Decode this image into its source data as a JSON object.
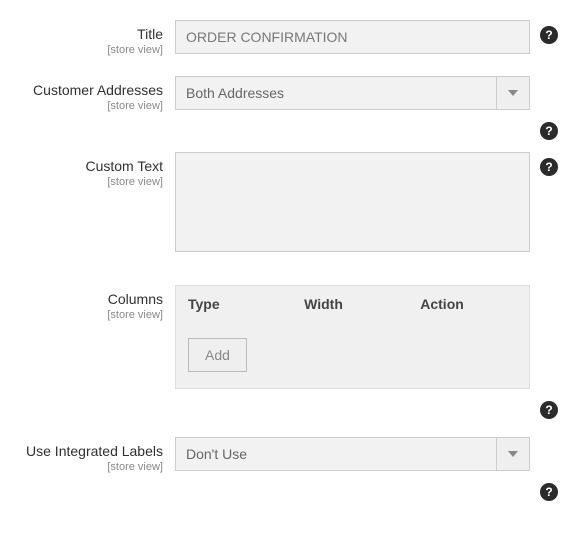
{
  "scope_label": "[store view]",
  "fields": {
    "title": {
      "label": "Title",
      "value": "ORDER CONFIRMATION"
    },
    "customer_addresses": {
      "label": "Customer Addresses",
      "selected": "Both Addresses"
    },
    "custom_text": {
      "label": "Custom Text",
      "value": ""
    },
    "columns": {
      "label": "Columns",
      "headers": {
        "type": "Type",
        "width": "Width",
        "action": "Action"
      },
      "add_label": "Add"
    },
    "use_integrated_labels": {
      "label": "Use Integrated Labels",
      "selected": "Don't Use"
    }
  },
  "help_tooltip": "?"
}
